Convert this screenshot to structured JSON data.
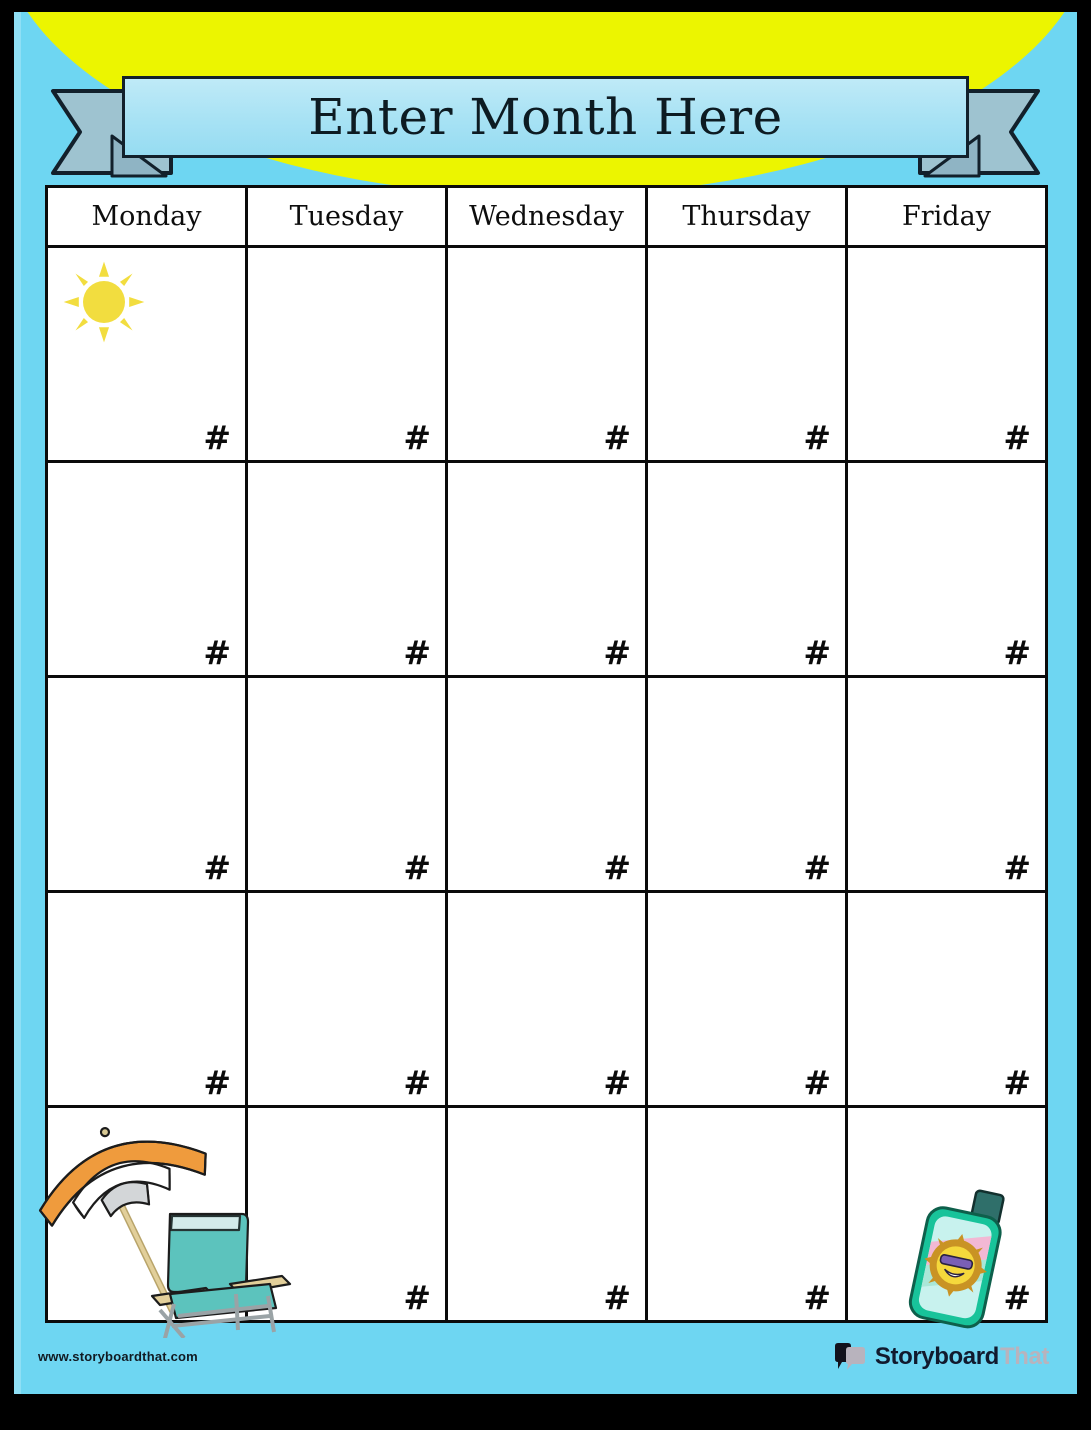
{
  "poster": {
    "type": "calendar-template",
    "theme": "summer-beach",
    "frame_color": "#000000",
    "background_color": "#6ed6f2",
    "sun_color": "#ecf500"
  },
  "banner": {
    "title": "Enter Month Here",
    "plate_color": "#a7e2f4",
    "tail_color": "#9ec3d0",
    "outline_color": "#12202b"
  },
  "calendar": {
    "day_headers": [
      "Monday",
      "Tuesday",
      "Wednesday",
      "Thursday",
      "Friday"
    ],
    "week_rows": 5,
    "date_placeholder": "#",
    "cells": [
      [
        {
          "date": "#"
        },
        {
          "date": "#"
        },
        {
          "date": "#"
        },
        {
          "date": "#"
        },
        {
          "date": "#"
        }
      ],
      [
        {
          "date": "#"
        },
        {
          "date": "#"
        },
        {
          "date": "#"
        },
        {
          "date": "#"
        },
        {
          "date": "#"
        }
      ],
      [
        {
          "date": "#"
        },
        {
          "date": "#"
        },
        {
          "date": "#"
        },
        {
          "date": "#"
        },
        {
          "date": "#"
        }
      ],
      [
        {
          "date": "#"
        },
        {
          "date": "#"
        },
        {
          "date": "#"
        },
        {
          "date": "#"
        },
        {
          "date": "#"
        }
      ],
      [
        {
          "date": "#"
        },
        {
          "date": "#"
        },
        {
          "date": "#"
        },
        {
          "date": "#"
        },
        {
          "date": "#"
        }
      ]
    ],
    "grid_line_color": "#0b0b0b",
    "cell_background": "#ffffff"
  },
  "decorations": {
    "cell_sun": {
      "name": "sun-icon",
      "color": "#f2dd3f",
      "cell": "monday-week-1"
    },
    "umbrella": {
      "name": "beach-umbrella-icon",
      "colors": [
        "#ef9b3d",
        "#ffffff",
        "#d3d6d8"
      ]
    },
    "beach_chair": {
      "name": "beach-chair-icon",
      "colors": [
        "#5cc3bd",
        "#e2cf9a"
      ]
    },
    "sunscreen": {
      "name": "sunscreen-bottle-icon",
      "colors": [
        "#18c39a",
        "#c8f2ee",
        "#f2b8d4"
      ]
    }
  },
  "footer": {
    "url": "www.storyboardthat.com",
    "logo_primary": "Storyboard",
    "logo_secondary": "That",
    "logo_primary_color": "#111a2e",
    "logo_secondary_color": "#b8b3bd"
  }
}
